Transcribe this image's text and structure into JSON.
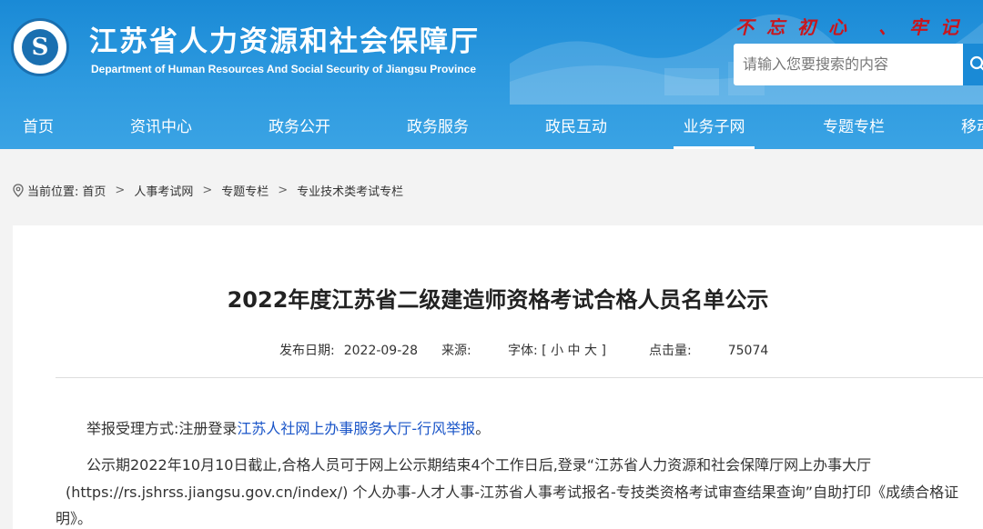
{
  "header": {
    "title": "江苏省人力资源和社会保障厅",
    "subtitle": "Department of Human Resources And Social Security of Jiangsu Province",
    "slogan": "不忘初心 、牢记",
    "search_placeholder": "请输入您要搜索的内容",
    "colors": {
      "primary": "#1a8ad6",
      "slogan": "#c8161d",
      "link": "#1a55c8"
    }
  },
  "nav": [
    "首页",
    "资讯中心",
    "政务公开",
    "政务服务",
    "政民互动",
    "业务子网",
    "专题专栏",
    "移动"
  ],
  "nav_active": "业务子网",
  "breadcrumb": {
    "prefix": "当前位置:",
    "items": [
      "首页",
      "人事考试网",
      "专题专栏",
      "专业技术类考试专栏"
    ],
    "separator": ">"
  },
  "article": {
    "title": "2022年度江苏省二级建造师资格考试合格人员名单公示",
    "meta": {
      "date_label": "发布日期:",
      "date": "2022-09-28",
      "source_label": "来源:",
      "font_label": "字体:",
      "font_open": "[",
      "font_small": "小",
      "font_medium": "中",
      "font_large": "大",
      "font_close": "]",
      "clicks_label": "点击量:",
      "clicks": "75074"
    },
    "p1_prefix": "举报受理方式:注册登录",
    "p1_link": "江苏人社网上办事服务大厅-行风举报",
    "p1_suffix": "。",
    "p2_line1": "公示期2022年10月10日截止,合格人员可于网上公示期结束4个工作日后,登录“江苏省人力资源和社会保障厅网上办事大厅",
    "p2_line2": "(https://rs.jshrss.jiangsu.gov.cn/index/) 个人办事-人才人事-江苏省人事考试报名-专技类资格考试审查结果查询”自助打印《成绩合格证",
    "p2_line3": "明》。"
  }
}
